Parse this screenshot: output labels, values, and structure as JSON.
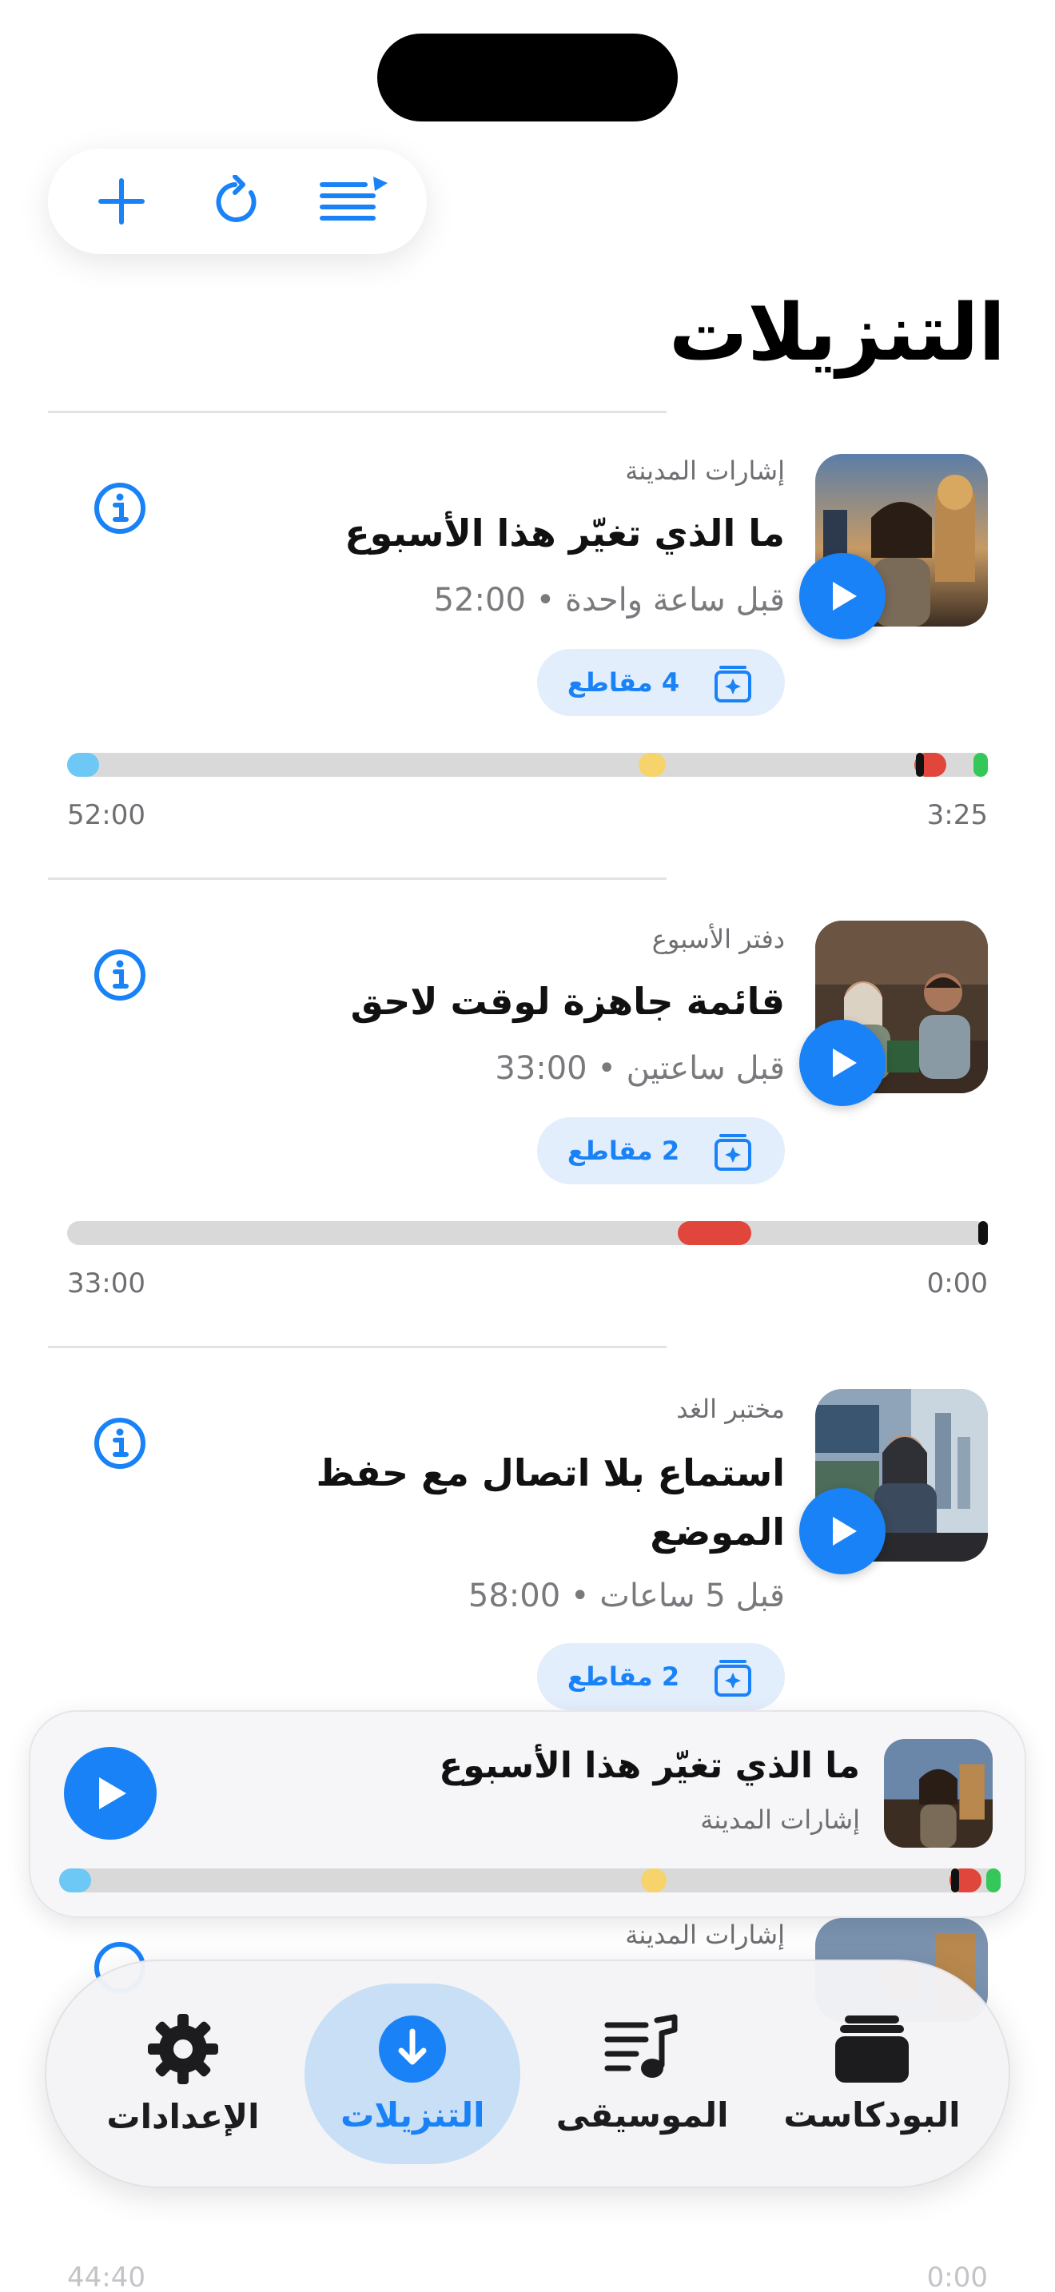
{
  "page": {
    "title": "التنزيلات"
  },
  "toolbar": {
    "add_icon": "plus-icon",
    "refresh_icon": "refresh-icon",
    "queue_icon": "queue-list-icon"
  },
  "colors": {
    "accent": "#1a82f7",
    "chip_bg": "#e3eefc",
    "marker_blue": "#6ec8f5",
    "marker_yellow": "#f7d36b",
    "marker_red": "#e0463c",
    "marker_green": "#34c759",
    "marker_black": "#111111"
  },
  "episodes": [
    {
      "podcast": "إشارات المدينة",
      "title": "ما الذي تغيّر هذا الأسبوع",
      "meta": "قبل ساعة واحدة  •  52:00",
      "chip": "4 مقاطع",
      "time_start": "52:00",
      "time_end": "3:25"
    },
    {
      "podcast": "دفتر الأسبوع",
      "title": "قائمة جاهزة لوقت لاحق",
      "meta": "قبل ساعتين  •  33:00",
      "chip": "2 مقاطع",
      "time_start": "33:00",
      "time_end": "0:00"
    },
    {
      "podcast": "مختبر الغد",
      "title": "استماع بلا اتصال مع حفظ الموضع",
      "meta": "قبل 5 ساعات  •  58:00",
      "chip": "2 مقاطع"
    },
    {
      "podcast": "إشارات المدينة",
      "time_start": "44:40",
      "time_end": "0:00"
    }
  ],
  "mini_player": {
    "title": "ما الذي تغيّر هذا الأسبوع",
    "podcast": "إشارات المدينة"
  },
  "tabs": [
    {
      "label": "البودكاست",
      "icon": "podcast-stack-icon"
    },
    {
      "label": "الموسيقى",
      "icon": "music-list-icon"
    },
    {
      "label": "التنزيلات",
      "icon": "download-icon",
      "active": true
    },
    {
      "label": "الإعدادات",
      "icon": "gear-icon"
    }
  ]
}
